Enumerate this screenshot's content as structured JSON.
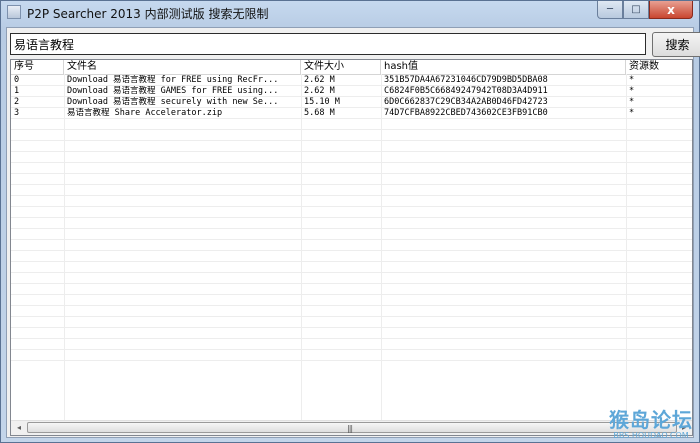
{
  "window": {
    "title": "P2P Searcher 2013 内部测试版 搜索无限制",
    "minimize_icon": "minimize-icon",
    "maximize_icon": "maximize-icon",
    "close_icon": "close-icon",
    "close_glyph": "x"
  },
  "search": {
    "value": "易语言教程",
    "button_label": "搜索"
  },
  "table": {
    "columns": [
      "序号",
      "文件名",
      "文件大小",
      "hash值",
      "资源数"
    ],
    "rows": [
      {
        "index": "0",
        "name": "Download 易语言教程 for FREE using RecFr...",
        "size": "2.62 M",
        "hash": "351B57DA4A67231046CD79D9BD5DBA08",
        "sources": "*"
      },
      {
        "index": "1",
        "name": "Download 易语言教程 GAMES for FREE using...",
        "size": "2.62 M",
        "hash": "C6824F0B5C66849247942T08D3A4D911",
        "sources": "*"
      },
      {
        "index": "2",
        "name": "Download 易语言教程 securely with new Se...",
        "size": "15.10 M",
        "hash": "6D0C662837C29CB34A2AB0D46FD42723",
        "sources": "*"
      },
      {
        "index": "3",
        "name": "易语言教程 Share Accelerator.zip",
        "size": "5.68 M",
        "hash": "74D7CFBA8922CBED743602CE3FB91CB0",
        "sources": "*"
      }
    ]
  },
  "scrollbar": {
    "left_arrow": "◂",
    "right_arrow": "▸",
    "grip": "|||"
  },
  "watermark": {
    "logo": "猴岛论坛",
    "url": "BBS.HOUDAO.COM"
  }
}
